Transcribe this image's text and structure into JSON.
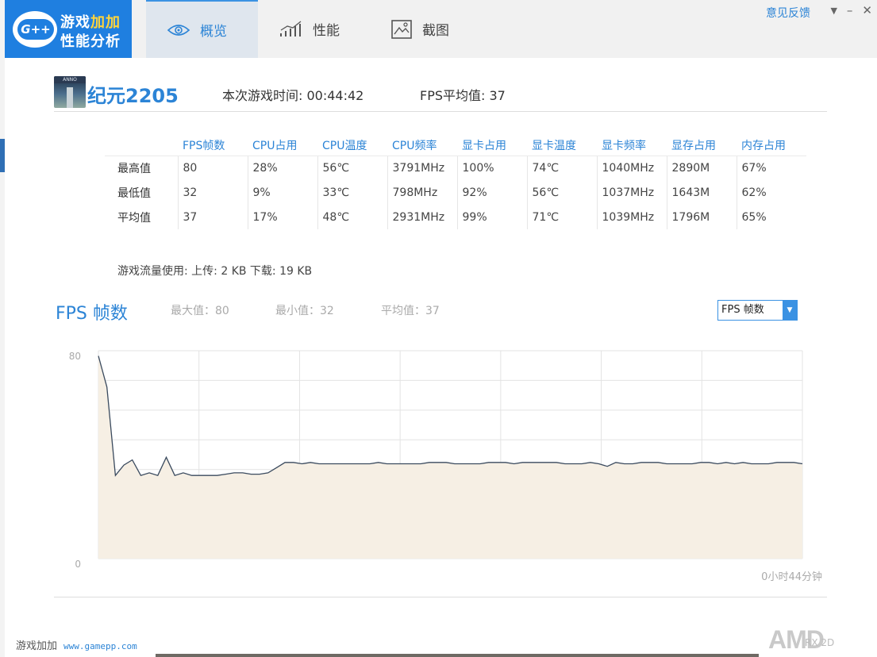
{
  "app": {
    "logo_line1_a": "游戏",
    "logo_line1_b": "加加",
    "logo_line2": "性能分析",
    "logo_badge": "G++"
  },
  "tabs": [
    {
      "label": "概览",
      "icon": "eye-icon",
      "active": true
    },
    {
      "label": "性能",
      "icon": "bar-chart-icon",
      "active": false
    },
    {
      "label": "截图",
      "icon": "screenshot-icon",
      "active": false
    }
  ],
  "header": {
    "feedback": "意见反馈",
    "menu_glyph": "▼",
    "minimize_glyph": "–",
    "close_glyph": "✕"
  },
  "game": {
    "thumb_text": "ANNO",
    "title": "纪元2205",
    "play_time": "本次游戏时间: 00:44:42",
    "fps_avg": "FPS平均值: 37"
  },
  "stats": {
    "headers": [
      "FPS帧数",
      "CPU占用",
      "CPU温度",
      "CPU频率",
      "显卡占用",
      "显卡温度",
      "显卡频率",
      "显存占用",
      "内存占用"
    ],
    "rows": [
      {
        "label": "最高值",
        "values": [
          "80",
          "28%",
          "56℃",
          "3791MHz",
          "100%",
          "74℃",
          "1040MHz",
          "2890M",
          "67%"
        ]
      },
      {
        "label": "最低值",
        "values": [
          "32",
          "9%",
          "33℃",
          "798MHz",
          "92%",
          "56℃",
          "1037MHz",
          "1643M",
          "62%"
        ]
      },
      {
        "label": "平均值",
        "values": [
          "37",
          "17%",
          "48℃",
          "2931MHz",
          "99%",
          "71℃",
          "1039MHz",
          "1796M",
          "65%"
        ]
      }
    ]
  },
  "traffic": "游戏流量使用: 上传: 2 KB   下载: 19 KB",
  "chart_header": {
    "title": "FPS 帧数",
    "max": "最大值：80",
    "min": "最小值：32",
    "avg": "平均值：37",
    "select_value": "FPS 帧数"
  },
  "chart_data": {
    "type": "area",
    "ylim": [
      0,
      80
    ],
    "ytick_labels": [
      "80",
      "0"
    ],
    "x_end_label": "0小时44分钟",
    "grid": true,
    "series": [
      {
        "values": [
          78,
          66,
          32,
          36,
          38,
          32,
          33,
          32,
          39,
          32,
          33,
          32,
          32,
          32,
          32,
          32.5,
          33,
          33,
          32.5,
          32.5,
          33,
          35,
          37,
          37,
          36.5,
          37,
          36.5,
          36.5,
          36.5,
          36.5,
          36.5,
          36.5,
          36.5,
          37,
          36.5,
          36.5,
          36.5,
          36.5,
          36.5,
          37,
          37,
          37,
          36.5,
          36.5,
          36.5,
          36.5,
          37,
          37,
          37,
          36.5,
          37,
          37,
          37,
          37,
          37,
          36.5,
          36.5,
          36.5,
          37,
          36.5,
          35.5,
          37,
          36.5,
          36.5,
          37,
          37,
          37,
          36.5,
          36.5,
          36.5,
          36.5,
          37,
          37,
          36.5,
          37,
          36.5,
          37,
          36.5,
          36.5,
          36.5,
          37,
          37,
          37,
          36.5
        ]
      }
    ]
  },
  "footer": {
    "brand": "游戏加加",
    "url": "www.gamepp.com",
    "amd": "AMD",
    "amd_sub": "RX 2D"
  },
  "colors": {
    "accent": "#2c84d6",
    "line": "#3a4a5e",
    "area_fill": "#f6efe4"
  }
}
